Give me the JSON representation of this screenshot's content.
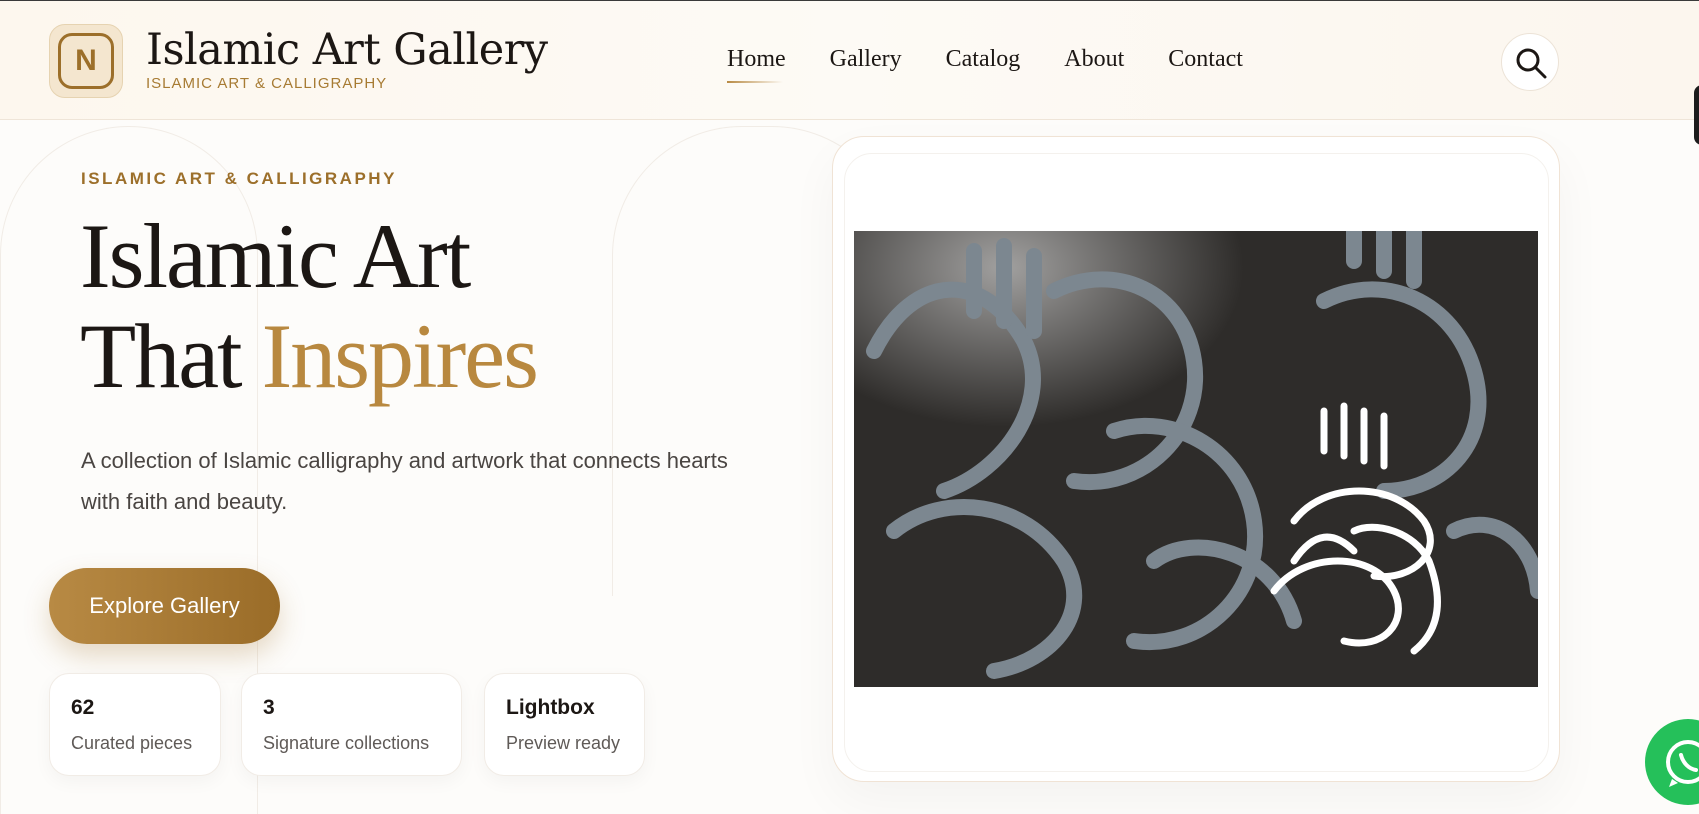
{
  "brand": {
    "logo_letter": "N",
    "title": "Islamic Art Gallery",
    "subtitle": "ISLAMIC ART & CALLIGRAPHY"
  },
  "nav": {
    "items": [
      {
        "label": "Home",
        "active": true
      },
      {
        "label": "Gallery",
        "active": false
      },
      {
        "label": "Catalog",
        "active": false
      },
      {
        "label": "About",
        "active": false
      },
      {
        "label": "Contact",
        "active": false
      }
    ],
    "search_icon": "search-icon"
  },
  "hero": {
    "eyebrow": "ISLAMIC ART & CALLIGRAPHY",
    "title_line1": "Islamic Art",
    "title_line2_plain": "That",
    "title_line2_accent": "Inspires",
    "description": "A collection of Islamic calligraphy and artwork that connects hearts with faith and beauty.",
    "cta_label": "Explore Gallery"
  },
  "stats": [
    {
      "value": "62",
      "label": "Curated pieces"
    },
    {
      "value": "3",
      "label": "Signature collections"
    },
    {
      "value": "Lightbox",
      "label": "Preview ready"
    }
  ],
  "artwork": {
    "subject": "Bismillah calligraphy artwork"
  },
  "floating": {
    "whatsapp_icon": "whatsapp-icon"
  },
  "colors": {
    "accent_gold": "#b8883f",
    "dark_text": "#1c1714",
    "cta_gradient_start": "#b88a44",
    "cta_gradient_end": "#9a6c28",
    "whatsapp_green": "#25c05a"
  }
}
